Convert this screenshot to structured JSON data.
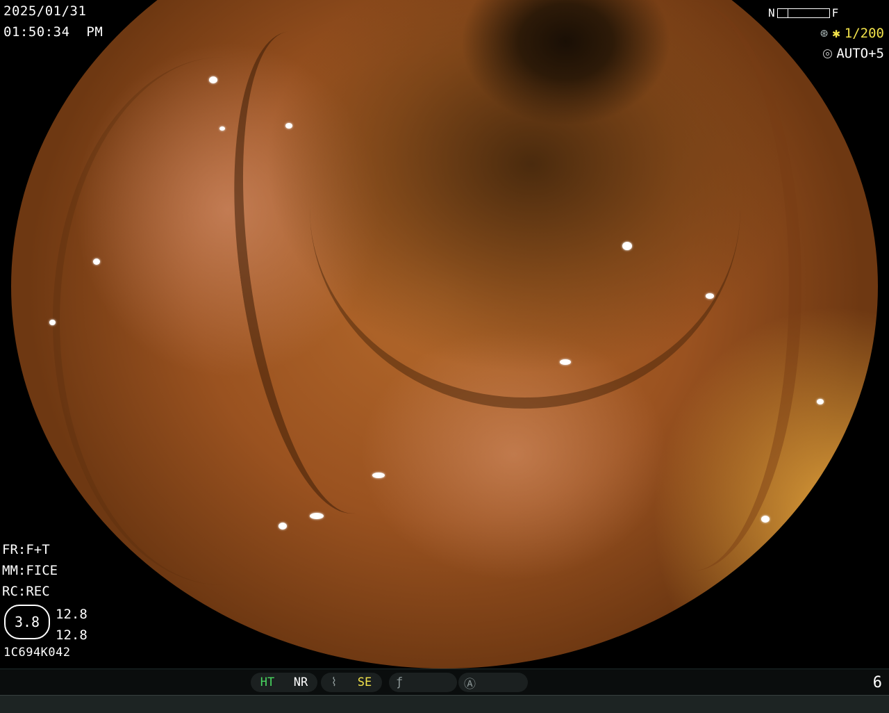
{
  "overlay": {
    "date": "2025/01/31",
    "time": "01:50:34  PM"
  },
  "top_right": {
    "nf_left": "N",
    "nf_right": "F",
    "shutter_marker": "✱",
    "shutter": "1/200",
    "auto_exposure": "AUTO+5"
  },
  "info": {
    "fr": "FR:F+T",
    "mm": "MM:FICE",
    "rc": "RC:REC",
    "hex_value": "3.8",
    "value_top": "12.8",
    "value_bottom": "12.8",
    "serial": "1C694K042"
  },
  "bottom_bar": {
    "ht": "HT",
    "nr": "NR",
    "se": "SE",
    "page_number": "6"
  },
  "icons": [
    "aperture-icon",
    "ring-icon",
    "waveform-icon",
    "italic-f-icon",
    "circle-a-icon"
  ],
  "colors": {
    "background": "#000000",
    "status_green": "#48d65f",
    "status_yellow": "#f2e24a",
    "bar_bg": "#0a0d0d"
  }
}
